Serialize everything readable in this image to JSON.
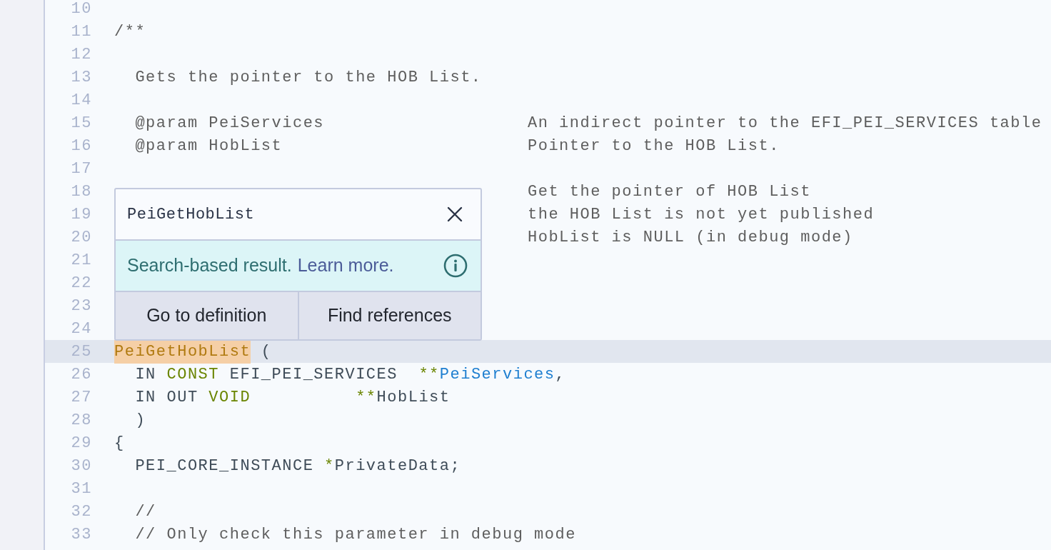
{
  "lines": [
    {
      "number": "10",
      "selected": false
    },
    {
      "number": "11",
      "selected": false,
      "tokens": [
        {
          "text": "/**",
          "kind": "comment"
        }
      ]
    },
    {
      "number": "12",
      "selected": false
    },
    {
      "number": "13",
      "selected": false,
      "tokens": [
        {
          "text": "  Gets the pointer to the HOB List.",
          "kind": "comment"
        }
      ]
    },
    {
      "number": "14",
      "selected": false
    },
    {
      "number": "15",
      "selected": false,
      "tokens": [
        {
          "text": "  @param PeiServices",
          "kind": "comment"
        }
      ],
      "note": "An indirect pointer to the EFI_PEI_SERVICES table"
    },
    {
      "number": "16",
      "selected": false,
      "tokens": [
        {
          "text": "  @param HobList",
          "kind": "comment"
        }
      ],
      "note": "Pointer to the HOB List."
    },
    {
      "number": "17",
      "selected": false
    },
    {
      "number": "18",
      "selected": false,
      "note": "Get the pointer of HOB List"
    },
    {
      "number": "19",
      "selected": false,
      "note": "the HOB List is not yet published"
    },
    {
      "number": "20",
      "selected": false,
      "note": "HobList is NULL (in debug mode)"
    },
    {
      "number": "21",
      "selected": false
    },
    {
      "number": "22",
      "selected": false
    },
    {
      "number": "23",
      "selected": false
    },
    {
      "number": "24",
      "selected": false
    },
    {
      "number": "25",
      "selected": true,
      "tokens": [
        {
          "text": "PeiGetHobList",
          "kind": "match"
        },
        {
          "text": " (",
          "kind": "plain"
        }
      ]
    },
    {
      "number": "26",
      "selected": false,
      "tokens": [
        {
          "text": "  IN ",
          "kind": "plain"
        },
        {
          "text": "CONST",
          "kind": "keyword"
        },
        {
          "text": " EFI_PEI_SERVICES  ",
          "kind": "plain"
        },
        {
          "text": "**",
          "kind": "keyword"
        },
        {
          "text": "PeiServices",
          "kind": "ident"
        },
        {
          "text": ",",
          "kind": "plain"
        }
      ]
    },
    {
      "number": "27",
      "selected": false,
      "tokens": [
        {
          "text": "  IN OUT ",
          "kind": "plain"
        },
        {
          "text": "VOID          ",
          "kind": "keyword"
        },
        {
          "text": "**",
          "kind": "keyword"
        },
        {
          "text": "HobList",
          "kind": "plain"
        }
      ]
    },
    {
      "number": "28",
      "selected": false,
      "tokens": [
        {
          "text": "  )",
          "kind": "plain"
        }
      ]
    },
    {
      "number": "29",
      "selected": false,
      "tokens": [
        {
          "text": "{",
          "kind": "plain"
        }
      ]
    },
    {
      "number": "30",
      "selected": false,
      "tokens": [
        {
          "text": "  PEI_CORE_INSTANCE ",
          "kind": "plain"
        },
        {
          "text": "*",
          "kind": "keyword"
        },
        {
          "text": "PrivateData;",
          "kind": "plain"
        }
      ]
    },
    {
      "number": "31",
      "selected": false
    },
    {
      "number": "32",
      "selected": false,
      "tokens": [
        {
          "text": "  //",
          "kind": "comment"
        }
      ]
    },
    {
      "number": "33",
      "selected": false,
      "tokens": [
        {
          "text": "  // Only check this parameter in debug mode",
          "kind": "comment"
        }
      ]
    }
  ],
  "popup": {
    "title": "PeiGetHobList",
    "notice": "Search-based result.",
    "link": "Learn more.",
    "buttons": [
      "Go to definition",
      "Find references"
    ]
  }
}
